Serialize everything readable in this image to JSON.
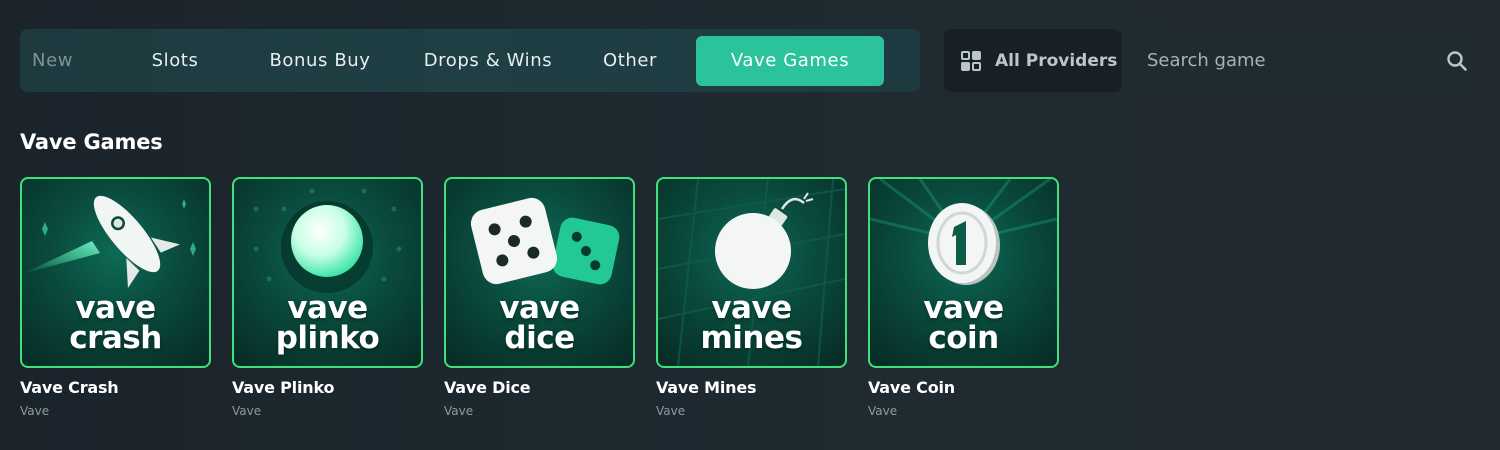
{
  "tabs": [
    {
      "label": "New",
      "active": false
    },
    {
      "label": "Slots",
      "active": false
    },
    {
      "label": "Bonus Buy",
      "active": false
    },
    {
      "label": "Drops & Wins",
      "active": false
    },
    {
      "label": "Other",
      "active": false
    },
    {
      "label": "Vave Games",
      "active": true
    }
  ],
  "providers": {
    "label": "All Providers",
    "icon": "grid-icon"
  },
  "search": {
    "placeholder": "Search game",
    "value": "",
    "icon": "search-icon"
  },
  "section": {
    "title": "Vave Games"
  },
  "games": [
    {
      "name": "Vave Crash",
      "provider": "Vave",
      "line1": "vave",
      "line2": "crash",
      "art": "rocket-icon"
    },
    {
      "name": "Vave Plinko",
      "provider": "Vave",
      "line1": "vave",
      "line2": "plinko",
      "art": "ball-icon"
    },
    {
      "name": "Vave Dice",
      "provider": "Vave",
      "line1": "vave",
      "line2": "dice",
      "art": "dice-icon"
    },
    {
      "name": "Vave Mines",
      "provider": "Vave",
      "line1": "vave",
      "line2": "mines",
      "art": "bomb-icon"
    },
    {
      "name": "Vave Coin",
      "provider": "Vave",
      "line1": "vave",
      "line2": "coin",
      "art": "coin-icon"
    }
  ],
  "colors": {
    "accent": "#2bc39b",
    "card_border": "#3fe07e",
    "background": "#1c252c"
  }
}
